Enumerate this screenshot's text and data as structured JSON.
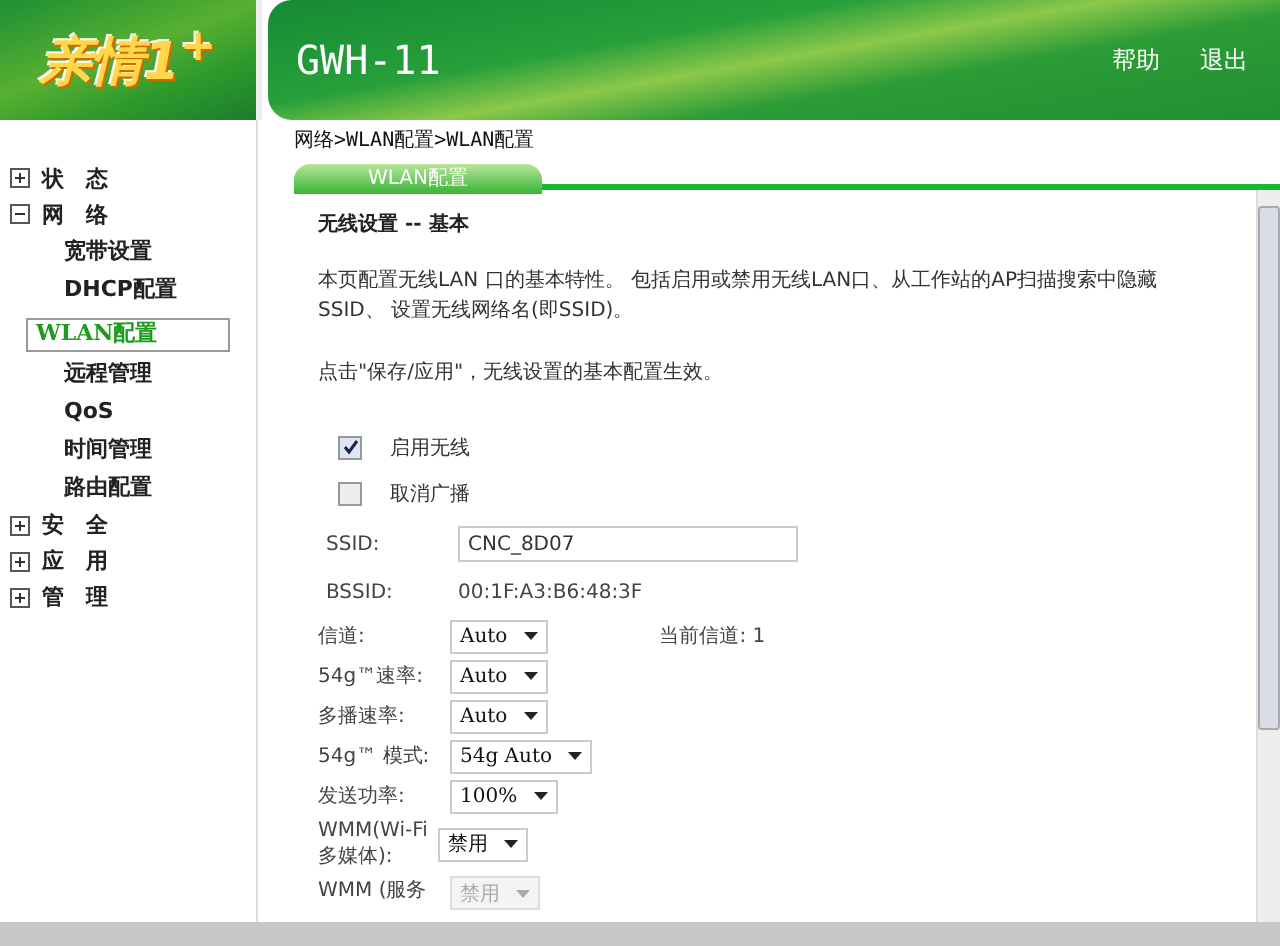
{
  "logo": "亲情1$^{+}$",
  "header": {
    "title": "GWH-11",
    "links": [
      "帮助",
      "退出"
    ]
  },
  "sidebar": {
    "items": [
      {
        "label": "状　态",
        "expanded": false
      },
      {
        "label": "网　络",
        "expanded": true,
        "children": [
          {
            "label": "宽带设置",
            "selected": false
          },
          {
            "label": "DHCP配置",
            "selected": false
          },
          {
            "label": "WLAN配置",
            "selected": true
          },
          {
            "label": "远程管理",
            "selected": false
          },
          {
            "label": "QoS",
            "selected": false
          },
          {
            "label": "时间管理",
            "selected": false
          },
          {
            "label": "路由配置",
            "selected": false
          }
        ]
      },
      {
        "label": "安　全",
        "expanded": false
      },
      {
        "label": "应　用",
        "expanded": false
      },
      {
        "label": "管　理",
        "expanded": false
      }
    ]
  },
  "breadcrumb": "网络>WLAN配置>WLAN配置",
  "tab": "WLAN配置",
  "section_title": "无线设置 -- 基本",
  "description": [
    "本页配置无线LAN 口的基本特性。 包括启用或禁用无线LAN口、从工作站的AP扫描搜索中隐藏SSID、 设置无线网络名(即SSID)。",
    "点击\"保存/应用\"，无线设置的基本配置生效。"
  ],
  "checkboxes": [
    {
      "label": "启用无线",
      "checked": true
    },
    {
      "label": "取消广播",
      "checked": false
    }
  ],
  "fields": [
    {
      "kind": "text",
      "label": "SSID:",
      "value": "CNC_8D07"
    },
    {
      "kind": "static",
      "label": "BSSID:",
      "value": "00:1F:A3:B6:48:3F"
    },
    {
      "kind": "select",
      "label": "信道:",
      "value": "Auto",
      "disabled": false,
      "note": "当前信道: 1"
    },
    {
      "kind": "select",
      "label": "54g™速率:",
      "value": "Auto",
      "disabled": false
    },
    {
      "kind": "select",
      "label": "多播速率:",
      "value": "Auto",
      "disabled": false
    },
    {
      "kind": "select",
      "label": "54g™ 模式:",
      "value": "54g Auto",
      "disabled": false
    },
    {
      "kind": "select",
      "label": "发送功率:",
      "value": "100%",
      "disabled": false
    },
    {
      "kind": "select",
      "label": "WMM(Wi-Fi 多媒体):",
      "value": "禁用",
      "disabled": false
    },
    {
      "kind": "select",
      "label": "WMM (服务",
      "value": "禁用",
      "disabled": true
    }
  ]
}
